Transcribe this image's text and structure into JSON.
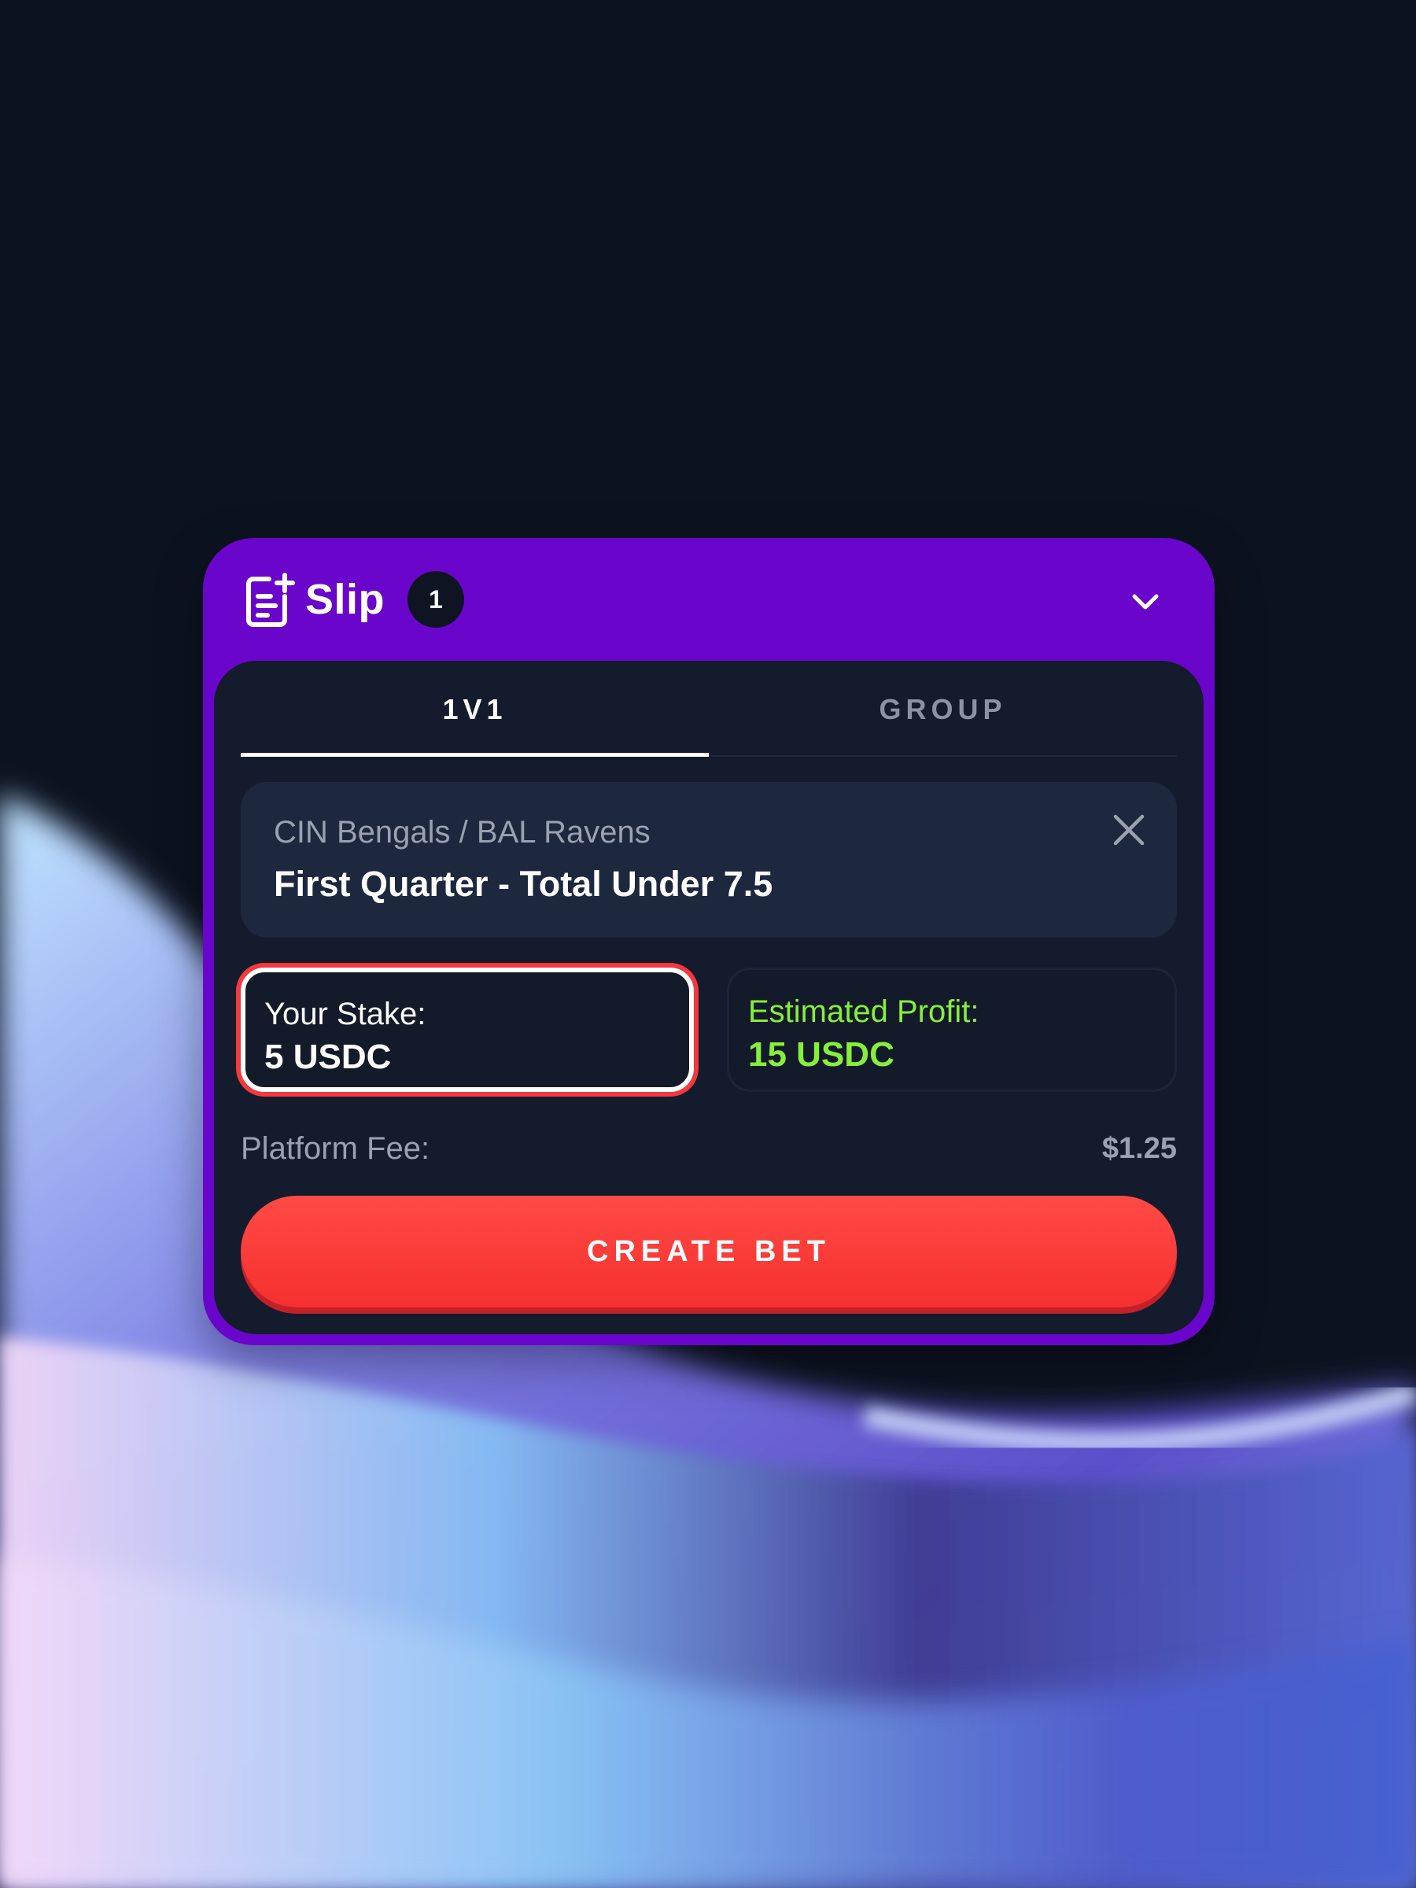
{
  "slip": {
    "title": "Slip",
    "count": "1"
  },
  "tabs": [
    {
      "label": "1V1",
      "active": true
    },
    {
      "label": "GROUP",
      "active": false
    }
  ],
  "bet": {
    "matchup": "CIN Bengals / BAL Ravens",
    "selection": "First Quarter - Total Under 7.5"
  },
  "stake": {
    "label": "Your Stake:",
    "value": "5 USDC"
  },
  "profit": {
    "label": "Estimated Profit:",
    "value": "15 USDC"
  },
  "fee": {
    "label": "Platform Fee:",
    "value": "$1.25"
  },
  "create_button": {
    "label": "CREATE BET"
  },
  "colors": {
    "header": "#6a05cc",
    "panel": "#141b2c",
    "bet_card": "#1d273d",
    "profit": "#86ef3a",
    "button": "#f6302f",
    "stake_outline": "#f3383e"
  },
  "icons": {
    "slip": "add-note-icon",
    "collapse": "chevron-down-icon",
    "remove": "close-icon"
  }
}
